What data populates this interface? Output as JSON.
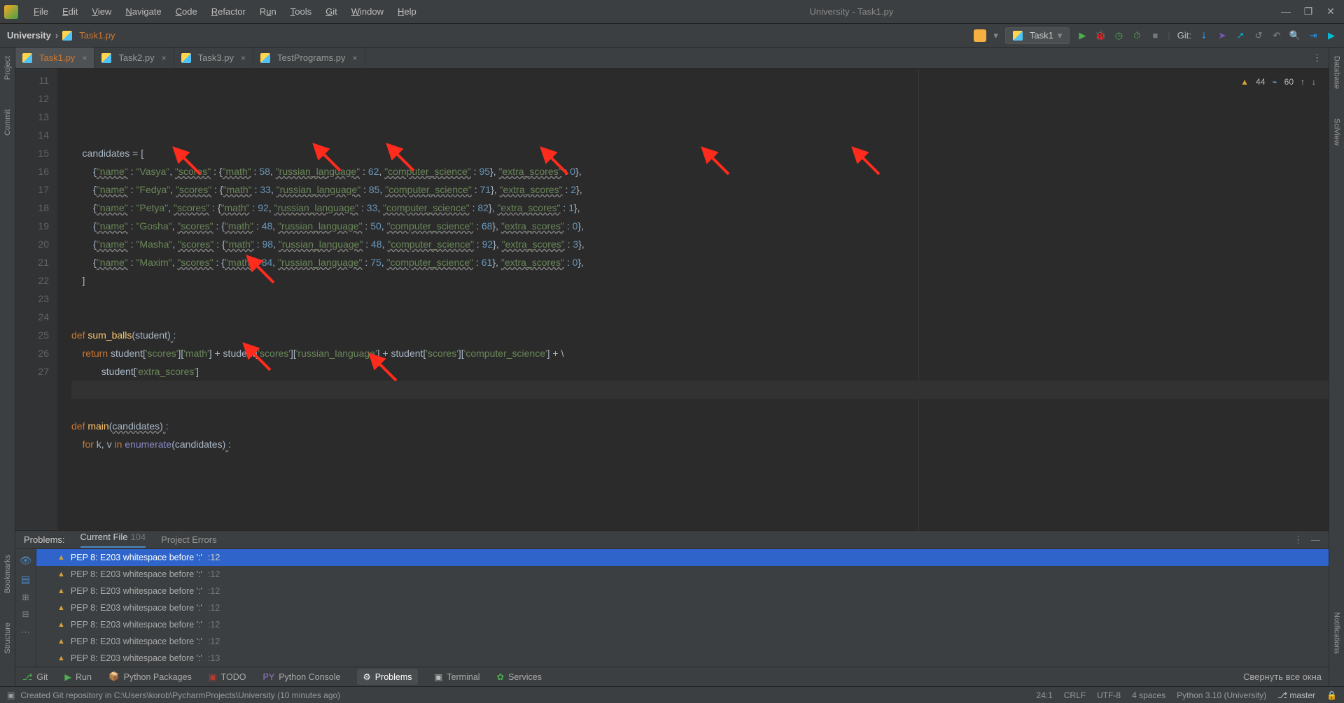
{
  "window": {
    "title": "University - Task1.py"
  },
  "menu": [
    "File",
    "Edit",
    "View",
    "Navigate",
    "Code",
    "Refactor",
    "Run",
    "Tools",
    "Git",
    "Window",
    "Help"
  ],
  "breadcrumb": {
    "project": "University",
    "file": "Task1.py"
  },
  "runConfig": {
    "name": "Task1"
  },
  "nav": {
    "git_label": "Git:"
  },
  "tabs": [
    {
      "name": "Task1.py",
      "active": true
    },
    {
      "name": "Task2.py",
      "active": false
    },
    {
      "name": "Task3.py",
      "active": false
    },
    {
      "name": "TestPrograms.py",
      "active": false
    }
  ],
  "inspections": {
    "warnings": 44,
    "weak": 60
  },
  "left_tabs": [
    "Project",
    "Commit",
    "Bookmarks",
    "Structure"
  ],
  "right_tabs": [
    "Database",
    "SciView",
    "Notifications"
  ],
  "editor": {
    "first_line": 11,
    "candidates": [
      {
        "name": "Vasya",
        "math": 58,
        "russian_language": 62,
        "computer_science": 95,
        "extra_scores": 0
      },
      {
        "name": "Fedya",
        "math": 33,
        "russian_language": 85,
        "computer_science": 71,
        "extra_scores": 2
      },
      {
        "name": "Petya",
        "math": 92,
        "russian_language": 33,
        "computer_science": 82,
        "extra_scores": 1
      },
      {
        "name": "Gosha",
        "math": 48,
        "russian_language": 50,
        "computer_science": 68,
        "extra_scores": 0
      },
      {
        "name": "Masha",
        "math": 98,
        "russian_language": 48,
        "computer_science": 92,
        "extra_scores": 3
      },
      {
        "name": "Maxim",
        "math": 84,
        "russian_language": 75,
        "computer_science": 61,
        "extra_scores": 0
      }
    ],
    "fn1": {
      "def": "def",
      "name": "sum_balls",
      "param": "student",
      "return_kw": "return",
      "expr1": "student['scores']['math'] + student['scores']['russian_language'] + student['scores']['computer_science'] + \\",
      "expr2": "student['extra_scores']"
    },
    "fn2": {
      "def": "def",
      "name": "main",
      "param": "candidates",
      "for_kw": "for",
      "vars": "k, v",
      "in_kw": "in",
      "enum": "enumerate",
      "arg": "candidates"
    },
    "keys": {
      "name": "\"name\"",
      "scores": "\"scores\"",
      "math": "\"math\"",
      "rus": "\"russian_language\"",
      "cs": "\"computer_science\"",
      "extra": "\"extra_scores\""
    },
    "head": "candidates = ["
  },
  "problems": {
    "title": "Problems:",
    "tabs": {
      "current": "Current File",
      "count": 104,
      "errors": "Project Errors"
    },
    "items": [
      {
        "msg": "PEP 8: E203 whitespace before ':'",
        "loc": ":12",
        "selected": true
      },
      {
        "msg": "PEP 8: E203 whitespace before ':'",
        "loc": ":12"
      },
      {
        "msg": "PEP 8: E203 whitespace before ':'",
        "loc": ":12"
      },
      {
        "msg": "PEP 8: E203 whitespace before ':'",
        "loc": ":12"
      },
      {
        "msg": "PEP 8: E203 whitespace before ':'",
        "loc": ":12"
      },
      {
        "msg": "PEP 8: E203 whitespace before ':'",
        "loc": ":12"
      },
      {
        "msg": "PEP 8: E203 whitespace before ':'",
        "loc": ":13"
      }
    ]
  },
  "toolstrip": {
    "items": [
      "Git",
      "Run",
      "Python Packages",
      "TODO",
      "Python Console",
      "Problems",
      "Terminal",
      "Services"
    ],
    "tip": "Свернуть все окна"
  },
  "status": {
    "msg": "Created Git repository in C:\\Users\\korob\\PycharmProjects\\University (10 minutes ago)",
    "pos": "24:1",
    "eol": "CRLF",
    "enc": "UTF-8",
    "indent": "4 spaces",
    "sdk": "Python 3.10 (University)",
    "branch": "master"
  }
}
